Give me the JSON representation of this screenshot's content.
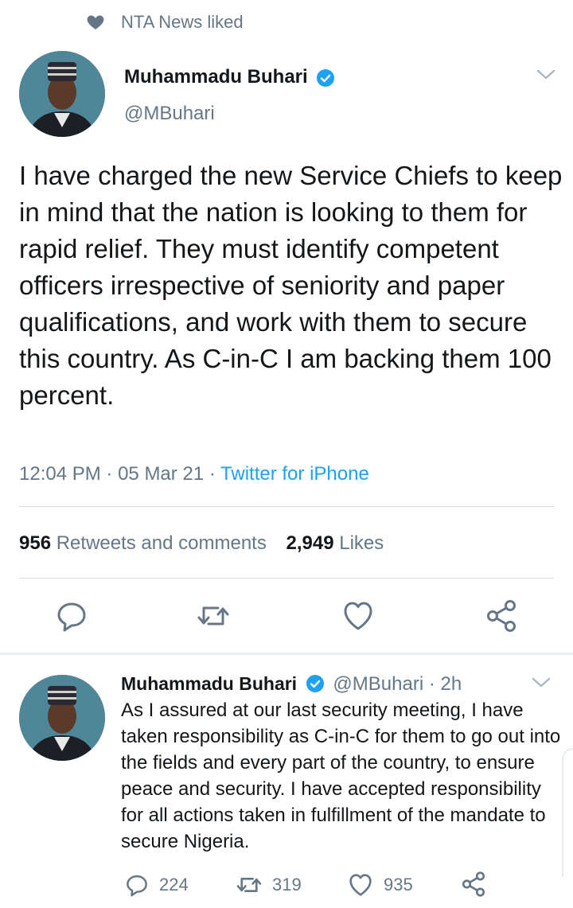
{
  "social_context": {
    "text": "NTA News liked",
    "icon": "heart-icon"
  },
  "main_tweet": {
    "author_name": "Muhammadu Buhari",
    "handle": "@MBuhari",
    "verified": true,
    "text": "I have charged the new Service Chiefs to keep in mind that the nation is looking to them for rapid relief. They must identify competent officers irrespective of seniority and paper qualifications, and work with them to secure this country. As C-in-C I am backing them 100 percent.",
    "time": "12:04 PM",
    "date": "05 Mar 21",
    "separator": "·",
    "source": "Twitter for iPhone",
    "retweets_count": "956",
    "retweets_label": "Retweets and comments",
    "likes_count": "2,949",
    "likes_label": "Likes",
    "actions": [
      "reply-icon",
      "retweet-icon",
      "like-icon",
      "share-icon"
    ]
  },
  "reply_tweet": {
    "author_name": "Muhammadu Buhari",
    "handle": "@MBuhari",
    "age": "· 2h",
    "verified": true,
    "text": "As I assured at our last security meeting, I have taken responsibility as C-in-C for them to go out into the fields and every part of the country, to ensure peace and security. I have accepted responsibility for all actions taken in fulfillment of the mandate to secure Nigeria.",
    "reply_count": "224",
    "retweet_count": "319",
    "like_count": "935"
  },
  "colors": {
    "accent": "#1da1f2",
    "secondary_text": "#657786",
    "divider": "#d6dce0"
  }
}
